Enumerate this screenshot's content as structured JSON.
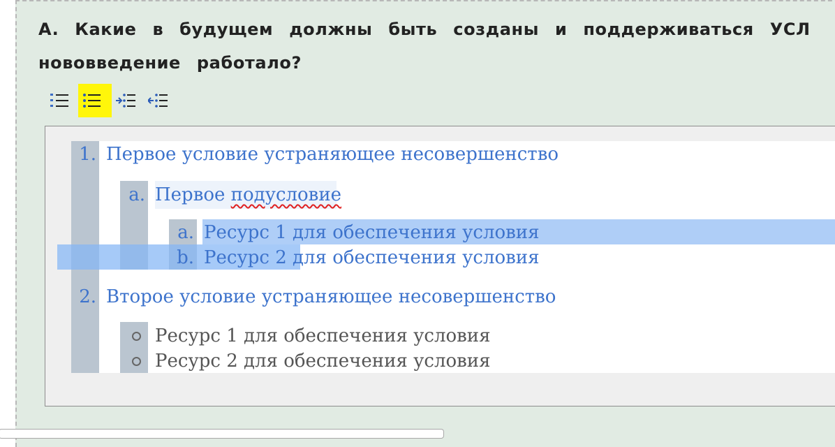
{
  "question": {
    "line1": "A. Какие в будущем должны быть созданы и поддерживаться УСЛ",
    "line2": "нововведение работало?"
  },
  "toolbar": {
    "buttons": [
      {
        "icon": "numbered-list-icon",
        "active": false
      },
      {
        "icon": "bulleted-list-icon",
        "active": true
      },
      {
        "icon": "indent-icon",
        "active": false
      },
      {
        "icon": "outdent-icon",
        "active": false
      }
    ],
    "active_color": "#fff60a"
  },
  "list": {
    "item1": {
      "marker": "1.",
      "text": "Первое условие устраняющее несовершенство",
      "sub": {
        "marker": "a.",
        "text_before": "Первое ",
        "text_misspelled": "подусловие",
        "resources": [
          {
            "marker": "a.",
            "text": "Ресурс 1 для обеспечения условия"
          },
          {
            "marker": "b.",
            "text": "Ресурс 2 для обеспечения условия"
          }
        ]
      }
    },
    "item2": {
      "marker": "2.",
      "text": "Второе условие устраняющее несовершенство",
      "resources": [
        {
          "text": "Ресурс 1 для обеспечения условия"
        },
        {
          "text": "Ресурс 2 для обеспечения условия"
        }
      ]
    }
  },
  "colors": {
    "panel_bg": "#e1ebe3",
    "link_blue": "#3d73cc",
    "gutter": "#bac5d0",
    "selection": "#98c0f5"
  }
}
